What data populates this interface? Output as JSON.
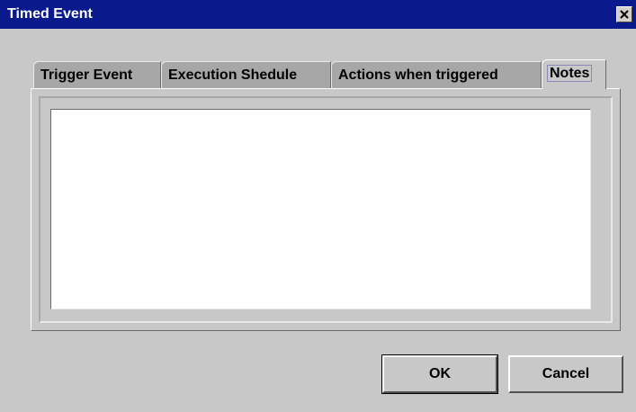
{
  "window": {
    "title": "Timed Event",
    "close_icon": "close-icon"
  },
  "tabs": [
    {
      "label": "Trigger Event",
      "active": false
    },
    {
      "label": "Execution Shedule",
      "active": false
    },
    {
      "label": "Actions when triggered",
      "active": false
    },
    {
      "label": "Notes",
      "active": true
    }
  ],
  "notes": {
    "value": ""
  },
  "buttons": {
    "ok_label": "OK",
    "cancel_label": "Cancel"
  },
  "colors": {
    "titlebar": "#0a1a8c",
    "background": "#c8c8c8",
    "inactive_tab": "#a7a7a7"
  }
}
